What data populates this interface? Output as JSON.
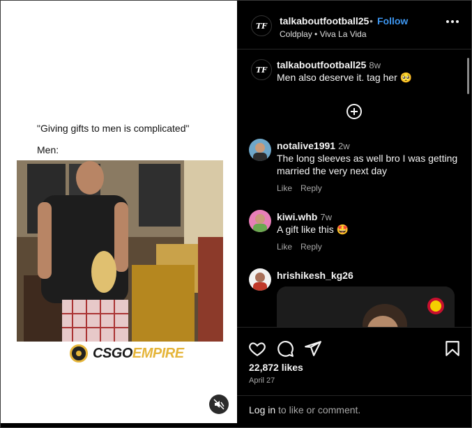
{
  "media": {
    "caption_line1": "\"Giving gifts to men is complicated\"",
    "caption_line2": "Men:",
    "brand_part1": "CSGO",
    "brand_part2": "EMPIRE",
    "mute_icon": "speaker-muted-icon"
  },
  "header": {
    "avatar_text": "TF",
    "username": "talkaboutfootball25",
    "separator": "•",
    "follow_label": "Follow",
    "song": "Coldplay • Viva La Vida",
    "more_icon": "more-horizontal-icon"
  },
  "post_caption": {
    "username": "talkaboutfootball25",
    "time": "8w",
    "text": "Men also deserve it. tag her 🥺"
  },
  "load_more_icon": "plus-circle-icon",
  "comments": [
    {
      "username": "notalive1991",
      "time": "2w",
      "text": "The long sleeves as well bro I was getting married the very next day",
      "like_label": "Like",
      "reply_label": "Reply"
    },
    {
      "username": "kiwi.whb",
      "time": "7w",
      "text": "A gift like this 🤩",
      "like_label": "Like",
      "reply_label": "Reply"
    },
    {
      "username": "hrishikesh_kg26",
      "time": "",
      "text": ""
    }
  ],
  "footer": {
    "icons": [
      "heart-icon",
      "comment-icon",
      "share-icon",
      "bookmark-icon"
    ],
    "likes": "22,872 likes",
    "date": "April 27",
    "login_link": "Log in",
    "login_rest": " to like or comment."
  },
  "colors": {
    "follow": "#3d96f0",
    "brand_gold": "#e5b53a",
    "panel_bg": "#000000",
    "muted_text": "#a8a8a8"
  }
}
